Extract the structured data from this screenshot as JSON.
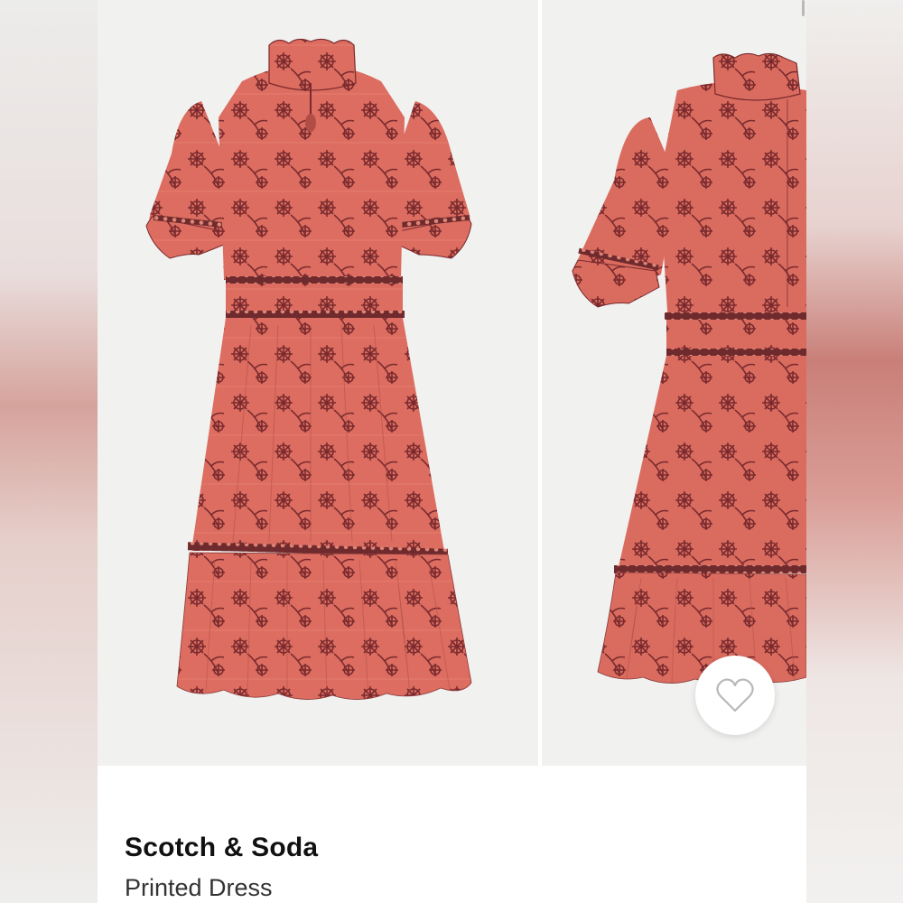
{
  "product": {
    "brand": "Scotch & Soda",
    "name": "Printed Dress"
  },
  "gallery": {
    "images": [
      {
        "view": "front",
        "icon": "dress-front-photo"
      },
      {
        "view": "back",
        "icon": "dress-back-photo"
      }
    ],
    "favorite_icon": "heart-outline-icon"
  },
  "colors": {
    "dress_main": "#d96a5e",
    "dress_print": "#7a2a2e",
    "dress_lace": "#6e2a2d",
    "background": "#f1f1f0",
    "text_primary": "#111111",
    "text_secondary": "#333333"
  }
}
